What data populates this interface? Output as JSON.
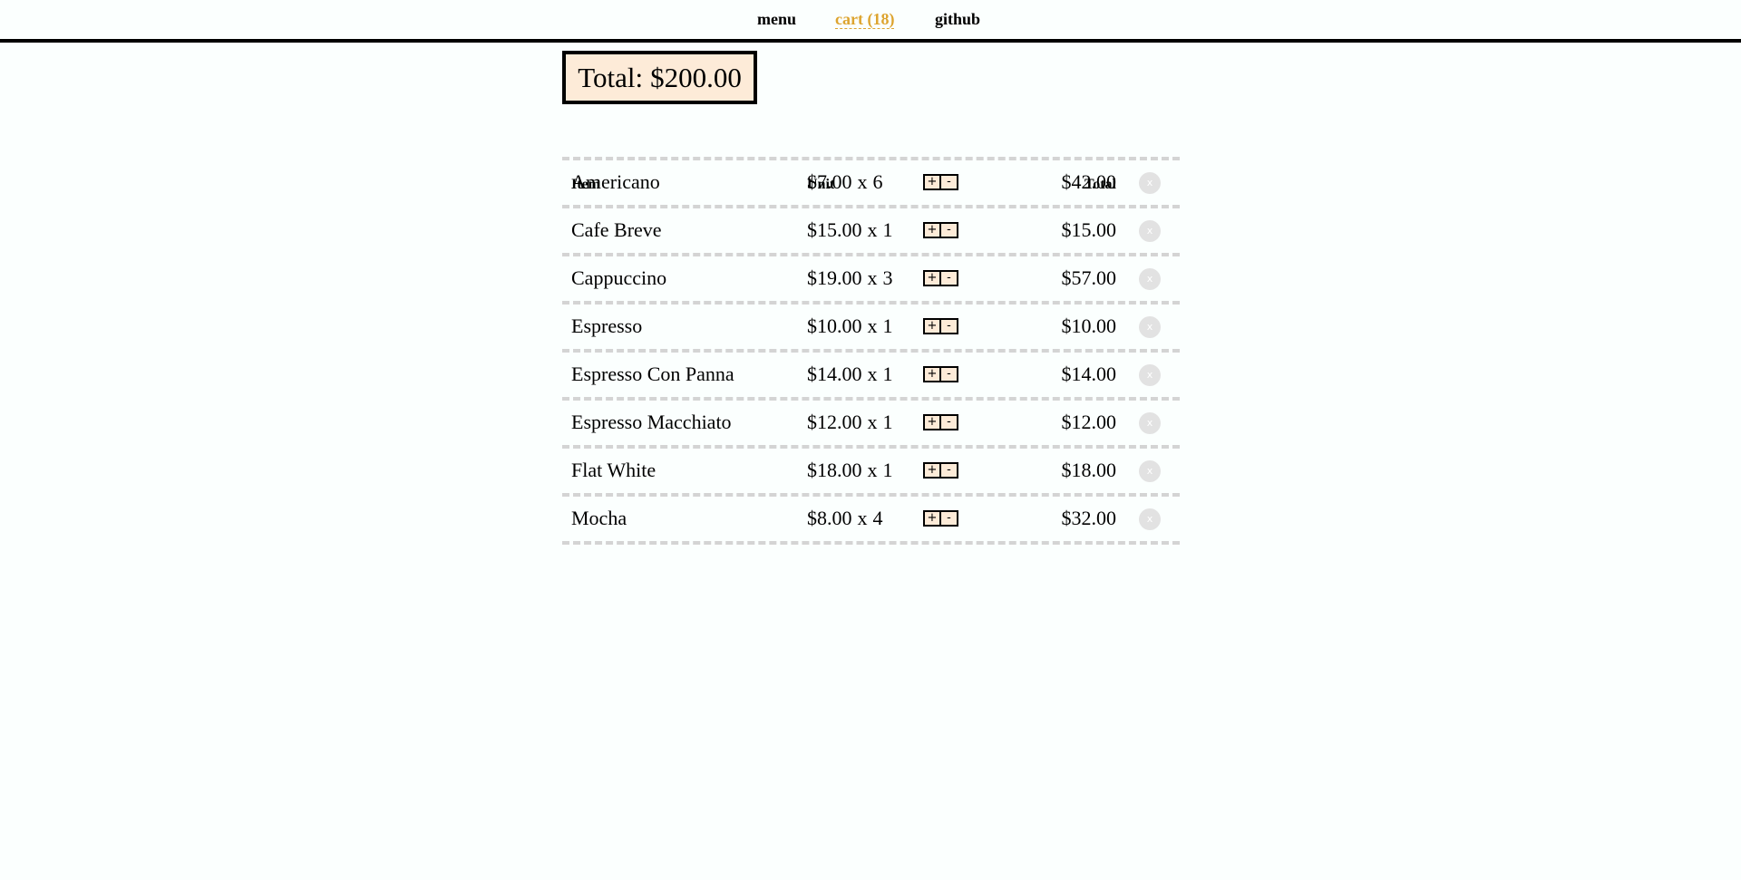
{
  "nav": {
    "menu": "menu",
    "cart": "cart (18)",
    "github": "github"
  },
  "summary": {
    "label": "Total:",
    "amount": "$200.00"
  },
  "table": {
    "headers": {
      "item": "Item",
      "unit": "Unit",
      "total": "Total"
    },
    "rows": [
      {
        "name": "Americano",
        "unit_price": "$7.00",
        "times": "x",
        "qty": "6",
        "total": "$42.00",
        "plus": "+",
        "minus": "-",
        "remove": "x"
      },
      {
        "name": "Cafe Breve",
        "unit_price": "$15.00",
        "times": "x",
        "qty": "1",
        "total": "$15.00",
        "plus": "+",
        "minus": "-",
        "remove": "x"
      },
      {
        "name": "Cappuccino",
        "unit_price": "$19.00",
        "times": "x",
        "qty": "3",
        "total": "$57.00",
        "plus": "+",
        "minus": "-",
        "remove": "x"
      },
      {
        "name": "Espresso",
        "unit_price": "$10.00",
        "times": "x",
        "qty": "1",
        "total": "$10.00",
        "plus": "+",
        "minus": "-",
        "remove": "x"
      },
      {
        "name": "Espresso Con Panna",
        "unit_price": "$14.00",
        "times": "x",
        "qty": "1",
        "total": "$14.00",
        "plus": "+",
        "minus": "-",
        "remove": "x"
      },
      {
        "name": "Espresso Macchiato",
        "unit_price": "$12.00",
        "times": "x",
        "qty": "1",
        "total": "$12.00",
        "plus": "+",
        "minus": "-",
        "remove": "x"
      },
      {
        "name": "Flat White",
        "unit_price": "$18.00",
        "times": "x",
        "qty": "1",
        "total": "$18.00",
        "plus": "+",
        "minus": "-",
        "remove": "x"
      },
      {
        "name": "Mocha",
        "unit_price": "$8.00",
        "times": "x",
        "qty": "4",
        "total": "$32.00",
        "plus": "+",
        "minus": "-",
        "remove": "x"
      }
    ]
  },
  "colors": {
    "accent": "#dda42f",
    "box_background": "#fdebd8",
    "page_background": "#fbfffe",
    "divider": "#d4d4d4"
  }
}
